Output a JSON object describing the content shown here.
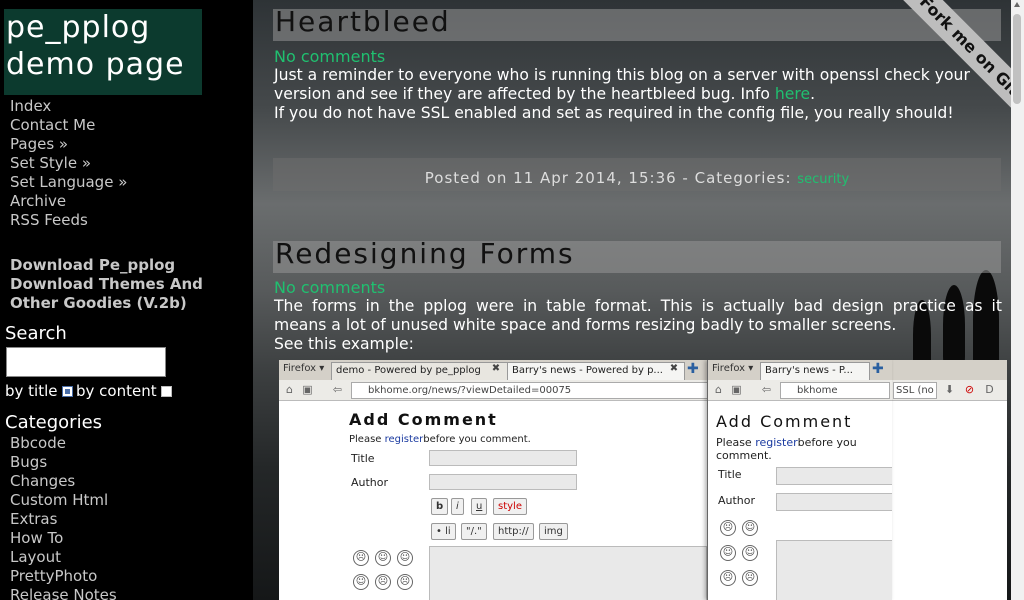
{
  "sidebar": {
    "logo_line1": "pe_pplog",
    "logo_line2": "demo page",
    "nav": [
      "Index",
      "Contact Me",
      "Pages »",
      "Set Style »",
      "Set Language »",
      "Archive",
      "RSS Feeds"
    ],
    "downloads": [
      "Download Pe_pplog",
      "Download Themes And",
      "Other Goodies (V.2b)"
    ],
    "search_heading": "Search",
    "by_title": "by title",
    "by_content": "by content",
    "categories_heading": "Categories",
    "categories": [
      "Bbcode",
      "Bugs",
      "Changes",
      "Custom Html",
      "Extras",
      "How To",
      "Layout",
      "PrettyPhoto",
      "Release Notes"
    ]
  },
  "ribbon": "Fork me on GitHub",
  "posts": [
    {
      "title": "Heartbleed",
      "comments": "No comments",
      "line1": "Just a reminder to everyone who is running this blog on a server with openssl check your",
      "line2_pre": "version and see if they are affected by the heartbleed bug. Info ",
      "line2_link": "here",
      "line2_post": ".",
      "line3": "If you do not have SSL enabled and set as required in the config file, you really should!",
      "posted": "Posted on 11 Apr 2014, 15:36 - Categories: ",
      "category": "security"
    },
    {
      "title": "Redesigning Forms",
      "comments": "No comments",
      "line1": "The forms in the pplog were in table format. This is actually bad design practice as it",
      "line2": "means a lot of unused white space and forms resizing badly to smaller screens.",
      "line3": "See this example:"
    }
  ],
  "example_image": {
    "browser_menu": "Firefox ▾",
    "tab1": "demo - Powered by pe_pplog",
    "tab2": "Barry's news - Powered by p...",
    "url": "bkhome.org/news/?viewDetailed=00075",
    "add_comment": "Add Comment",
    "please": "Please ",
    "register": "register",
    "before": "before you comment.",
    "title_label": "Title",
    "author_label": "Author",
    "buttons_row1": [
      "b",
      "i",
      "u",
      "style"
    ],
    "buttons_row2": [
      "• li",
      "\"/.\"",
      "http://",
      "img"
    ],
    "win2_menu": "Firefox ▾",
    "win2_tab": "Barry's news - P...",
    "win2_url": "bkhome",
    "win2_ssl": "SSL (no",
    "win2_add_comment": "Add Comment",
    "win2_please": "Please ",
    "win2_register": "register",
    "win2_before": "before you",
    "win2_comment": "comment."
  },
  "colors": {
    "accent_green": "#20c070",
    "logo_bg": "#0c3a2e"
  }
}
